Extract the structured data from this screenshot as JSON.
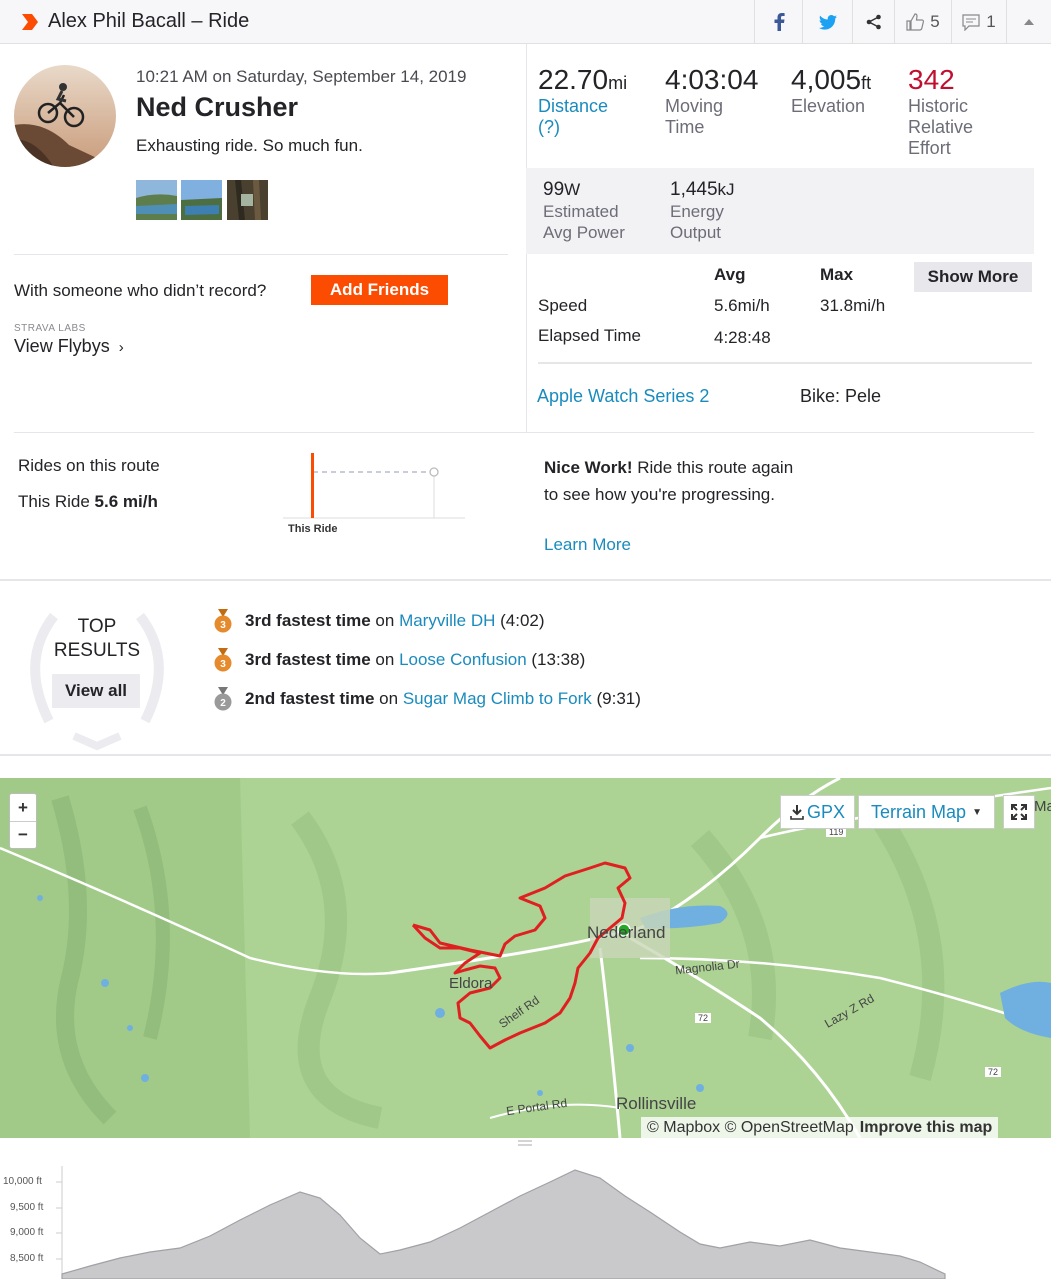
{
  "header": {
    "title": "Alex Phil Bacall – Ride",
    "kudos_count": "5",
    "comments_count": "1",
    "brand_color": "#fc4c02"
  },
  "activity": {
    "datetime": "10:21 AM on Saturday, September 14, 2019",
    "name": "Ned Crusher",
    "description": "Exhausting ride. So much fun."
  },
  "stats": {
    "distance": {
      "value": "22.70",
      "unit": "mi",
      "label": "Distance (?)"
    },
    "moving_time": {
      "value": "4:03:04",
      "label": "Moving Time"
    },
    "elevation": {
      "value": "4,005",
      "unit": "ft",
      "label": "Elevation"
    },
    "relative_effort": {
      "value": "342",
      "label": "Historic Relative Effort"
    },
    "avg_power": {
      "value": "99",
      "unit": "W",
      "label": "Estimated Avg Power"
    },
    "energy": {
      "value": "1,445",
      "unit": "kJ",
      "label": "Energy Output"
    }
  },
  "table": {
    "avg_header": "Avg",
    "max_header": "Max",
    "speed_label": "Speed",
    "speed_avg": "5.6mi/h",
    "speed_max": "31.8mi/h",
    "elapsed_label": "Elapsed Time",
    "elapsed_avg": "4:28:48",
    "show_more": "Show More"
  },
  "device": "Apple Watch Series 2",
  "bike": "Bike: Pele",
  "friends": {
    "prompt": "With someone who didn’t record?",
    "button": "Add Friends"
  },
  "flybys": {
    "labs_label": "STRAVA LABS",
    "link": "View Flybys"
  },
  "route": {
    "title": "Rides on this route",
    "this_ride_label": "This Ride",
    "this_ride_speed": "5.6 mi/h",
    "chart_label": "This Ride",
    "nice_work_bold": "Nice Work!",
    "nice_work_text": "Ride this route again to see how you're progressing.",
    "learn_more": "Learn More"
  },
  "top_results": {
    "label_line1": "TOP",
    "label_line2": "RESULTS",
    "view_all": "View all",
    "items": [
      {
        "medal": "3",
        "rank": "3rd fastest time",
        "on": "on",
        "segment": "Maryville DH",
        "time": "(4:02)"
      },
      {
        "medal": "3",
        "rank": "3rd fastest time",
        "on": "on",
        "segment": "Loose Confusion",
        "time": "(13:38)"
      },
      {
        "medal": "2",
        "rank": "2nd fastest time",
        "on": "on",
        "segment": "Sugar Mag Climb to Fork",
        "time": "(9:31)"
      }
    ]
  },
  "map": {
    "zoom_in": "+",
    "zoom_out": "−",
    "gpx": "GPX",
    "style": "Terrain Map",
    "places": {
      "nederland": "Nederland",
      "eldora": "Eldora",
      "rollinsville": "Rollinsville",
      "magnolia": "Magnolia Dr",
      "lazy_z": "Lazy Z Rd",
      "shelf": "Shelf Rd",
      "peak": "E Portal Rd",
      "hwy119": "119",
      "hwy72a": "72",
      "hwy72b": "72",
      "edge": "Ma"
    },
    "attribution_mapbox": "© Mapbox",
    "attribution_osm": "© OpenStreetMap",
    "attribution_improve": "Improve this map"
  },
  "elevation": {
    "ticks": [
      "10,000 ft",
      "9,500 ft",
      "9,000 ft",
      "8,500 ft"
    ]
  }
}
